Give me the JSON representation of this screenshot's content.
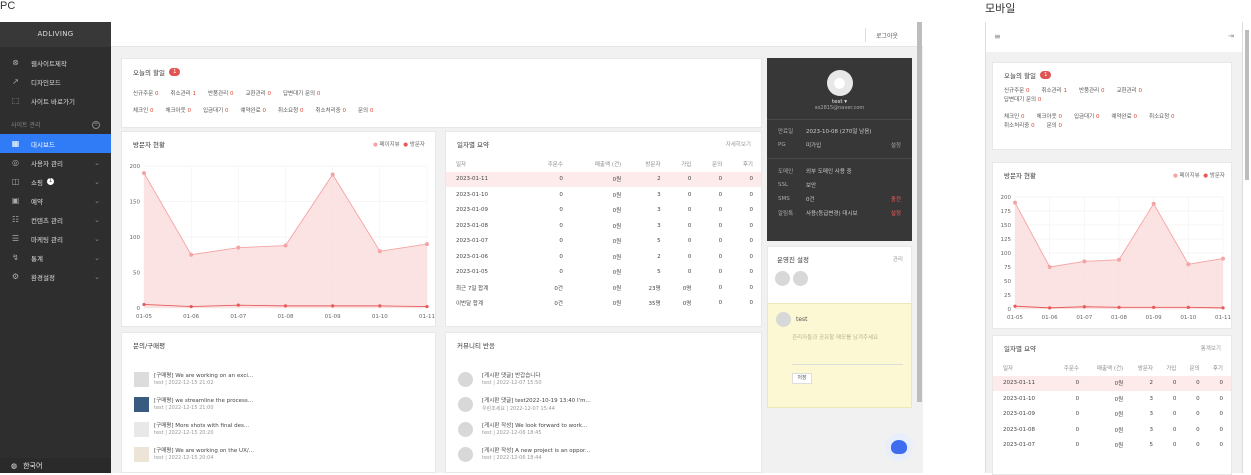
{
  "labels": {
    "pc": "PC",
    "mobile": "모바일"
  },
  "sidebar": {
    "brand": "ADLIVING",
    "links": [
      {
        "label": "웹사이트제작",
        "icon": "close-circle-icon"
      },
      {
        "label": "디자인모드",
        "icon": "brush-icon"
      },
      {
        "label": "사이트 바로가기",
        "icon": "external-link-icon"
      }
    ],
    "section": "사이트 관리",
    "items": [
      {
        "label": "대시보드",
        "icon": "grid-icon",
        "active": true
      },
      {
        "label": "사용자 관리",
        "icon": "users-icon"
      },
      {
        "label": "쇼핑",
        "icon": "cart-icon",
        "badge": "1"
      },
      {
        "label": "예약",
        "icon": "calendar-icon"
      },
      {
        "label": "컨텐츠 관리",
        "icon": "contents-icon"
      },
      {
        "label": "마케팅 관리",
        "icon": "marketing-icon"
      },
      {
        "label": "통계",
        "icon": "stats-icon"
      },
      {
        "label": "환경설정",
        "icon": "gear-icon"
      }
    ],
    "language": "한국어"
  },
  "topbar": {
    "logout": "로그아웃"
  },
  "today": {
    "title": "오늘의 할일",
    "count": "1",
    "row1": [
      {
        "label": "신규주문",
        "value": "0"
      },
      {
        "label": "취소관리",
        "value": "1"
      },
      {
        "label": "반품관리",
        "value": "0"
      },
      {
        "label": "교환관리",
        "value": "0"
      },
      {
        "label": "답변대기 문의",
        "value": "0"
      }
    ],
    "row2": [
      {
        "label": "체크인",
        "value": "0"
      },
      {
        "label": "체크아웃",
        "value": "0"
      },
      {
        "label": "입금대기",
        "value": "0"
      },
      {
        "label": "예약완료",
        "value": "0"
      },
      {
        "label": "취소요청",
        "value": "0"
      },
      {
        "label": "취소처리중",
        "value": "0"
      },
      {
        "label": "문의",
        "value": "0"
      }
    ]
  },
  "visitors": {
    "title": "방문자 현황",
    "legend": [
      "페이지뷰",
      "방문자"
    ]
  },
  "chart_data": {
    "type": "area",
    "categories": [
      "01-05",
      "01-06",
      "01-07",
      "01-08",
      "01-09",
      "01-10",
      "01-11"
    ],
    "series": [
      {
        "name": "페이지뷰",
        "values": [
          190,
          75,
          85,
          88,
          188,
          80,
          90
        ]
      },
      {
        "name": "방문자",
        "values": [
          5,
          2,
          4,
          3,
          3,
          3,
          2
        ]
      }
    ],
    "ylim": [
      0,
      200
    ],
    "yticks": [
      0,
      25,
      50,
      75,
      100,
      125,
      150,
      175,
      200
    ],
    "yticks_pc": [
      0,
      50,
      100,
      150,
      200
    ],
    "grid": true,
    "legend": "top-right",
    "colors": [
      "#f4a4a4",
      "#e65a5a"
    ]
  },
  "daily": {
    "title": "일자별 요약",
    "more": "자세히보기",
    "more_mobile": "통계보기",
    "headers": [
      "일자",
      "주문수",
      "매출액 (건)",
      "방문자",
      "가입",
      "문의",
      "후기"
    ],
    "rows": [
      [
        "2023-01-11",
        "0",
        "0원",
        "2",
        "0",
        "0",
        "0"
      ],
      [
        "2023-01-10",
        "0",
        "0원",
        "3",
        "0",
        "0",
        "0"
      ],
      [
        "2023-01-09",
        "0",
        "0원",
        "3",
        "0",
        "0",
        "0"
      ],
      [
        "2023-01-08",
        "0",
        "0원",
        "3",
        "0",
        "0",
        "0"
      ],
      [
        "2023-01-07",
        "0",
        "0원",
        "5",
        "0",
        "0",
        "0"
      ],
      [
        "2023-01-06",
        "0",
        "0원",
        "2",
        "0",
        "0",
        "0"
      ],
      [
        "2023-01-05",
        "0",
        "0원",
        "5",
        "0",
        "0",
        "0"
      ]
    ],
    "summary": [
      [
        "최근 7일 합계",
        "0건",
        "0원",
        "23명",
        "0명",
        "0",
        "0"
      ],
      [
        "이번달 합계",
        "0건",
        "0원",
        "35명",
        "0명",
        "0",
        "0"
      ]
    ]
  },
  "profile": {
    "name": "test ▾",
    "email": "so2815@naver.com",
    "rows1": [
      {
        "k": "만료일",
        "v": "2023-10-08 (270일 남음)",
        "r": ""
      },
      {
        "k": "PG",
        "v": "미가입",
        "r": "설정"
      }
    ],
    "rows2": [
      {
        "k": "도메인",
        "v": "외부 도메인 사용 중",
        "r": ""
      },
      {
        "k": "SSL",
        "v": "보안",
        "r": ""
      },
      {
        "k": "SMS",
        "v": "0건",
        "r": "충전"
      },
      {
        "k": "알림톡",
        "v": "사용(등급변경) 대시보",
        "r": "설정"
      }
    ]
  },
  "staff": {
    "title": "운영진 설정",
    "action": "관리"
  },
  "memo": {
    "user": "test",
    "placeholder": "관리자들과 공유할 메모를 남겨주세요",
    "button": "저장"
  },
  "inquiries": {
    "title": "문의/구매평",
    "items": [
      {
        "title": "[구매평] We are working on an exci...",
        "meta": "test | 2022-12-15 21:02"
      },
      {
        "title": "[구매평] we streamline the process...",
        "meta": "test | 2022-12-15 21:00"
      },
      {
        "title": "[구매평] More shots with final des...",
        "meta": "test | 2022-12-15 20:20"
      },
      {
        "title": "[구매평] We are working on the UX/...",
        "meta": "test | 2022-12-15 20:04"
      }
    ]
  },
  "community": {
    "title": "커뮤니티 반응",
    "items": [
      {
        "title": "[게시판 댓글] 반갑습니다",
        "meta": "test | 2022-12-07 15:50"
      },
      {
        "title": "[게시판 댓글] test2022-10-19 13:40 I'm...",
        "meta": "우린조세요 | 2022-12-07 15:44"
      },
      {
        "title": "[게시판 작성] We look forward to work...",
        "meta": "test | 2022-12-06 18:45"
      },
      {
        "title": "[게시판 작성] A new project is an oppor...",
        "meta": "test | 2022-12-06 18:44"
      }
    ]
  }
}
